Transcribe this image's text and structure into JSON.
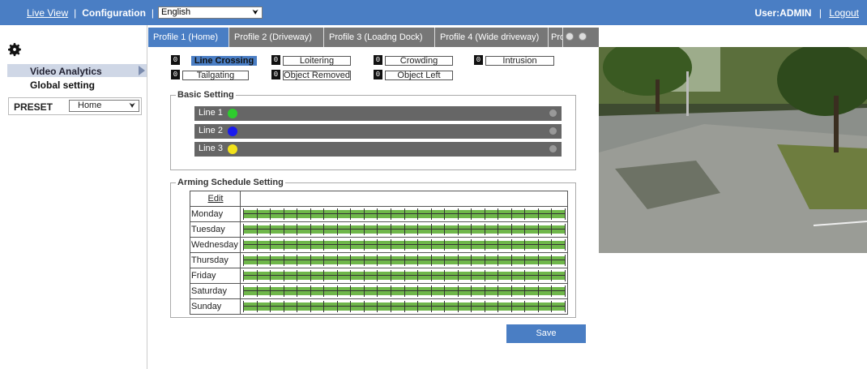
{
  "topbar": {
    "live_view": "Live View",
    "separator": "|",
    "configuration": "Configuration",
    "language": "English",
    "user": "User:ADMIN",
    "logout": "Logout"
  },
  "sidebar": {
    "items": [
      {
        "label": "Video Analytics"
      },
      {
        "label": "Global setting"
      }
    ],
    "preset_label": "PRESET",
    "preset_value": "Home"
  },
  "tabs": [
    {
      "label": "Profile 1  (Home)"
    },
    {
      "label": "Profile 2  (Driveway)"
    },
    {
      "label": "Profile 3  (Loadng Dock)"
    },
    {
      "label": "Profile 4  (Wide driveway)"
    },
    {
      "label": "Pro"
    }
  ],
  "detections": [
    {
      "count": "0",
      "label": "Line Crossing"
    },
    {
      "count": "0",
      "label": "Loitering"
    },
    {
      "count": "0",
      "label": "Crowding"
    },
    {
      "count": "0",
      "label": "Intrusion"
    },
    {
      "count": "0",
      "label": "Tailgating"
    },
    {
      "count": "0",
      "label": "Object Removed"
    },
    {
      "count": "0",
      "label": "Object Left"
    }
  ],
  "basic_setting": {
    "title": "Basic Setting",
    "lines": [
      {
        "label": "Line 1",
        "color": "#2ecc2e"
      },
      {
        "label": "Line 2",
        "color": "#1a1aee"
      },
      {
        "label": "Line 3",
        "color": "#f2e21a"
      }
    ]
  },
  "schedule": {
    "title": "Arming Schedule Setting",
    "edit": "Edit",
    "days": [
      "Monday",
      "Tuesday",
      "Wednesday",
      "Thursday",
      "Friday",
      "Saturday",
      "Sunday"
    ],
    "bar_color": "#6fb74a"
  },
  "save_label": "Save",
  "colors": {
    "accent": "#4a7ec4"
  }
}
